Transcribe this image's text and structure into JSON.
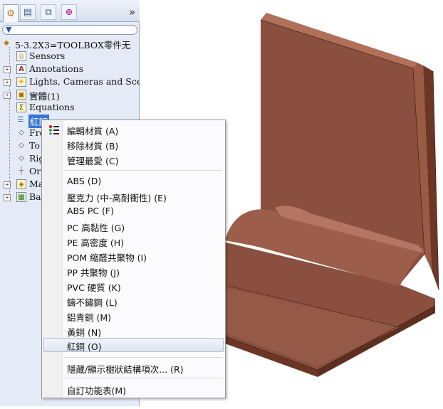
{
  "panel": {
    "tabs": [
      {
        "name": "feature-manager-tab-icon",
        "glyph": "⚙"
      },
      {
        "name": "property-manager-tab-icon",
        "glyph": "▤"
      },
      {
        "name": "configuration-manager-tab-icon",
        "glyph": "⧉"
      },
      {
        "name": "dimxpert-tab-icon",
        "glyph": "⊕"
      }
    ],
    "more_glyph": "»",
    "filter_glyph": "▼",
    "tree": {
      "root": "5-3.2X3=TOOLBOX零件无",
      "items": [
        {
          "label": "Sensors",
          "icon": "sensor-icon",
          "glyph": "◎",
          "expandable": false
        },
        {
          "label": "Annotations",
          "icon": "annotation-icon",
          "glyph": "A",
          "expandable": true
        },
        {
          "label": "Lights, Cameras and Scene",
          "icon": "lights-icon",
          "glyph": "☀",
          "expandable": true
        },
        {
          "label": "實體(1)",
          "icon": "solid-bodies-icon",
          "glyph": "▣",
          "expandable": true
        },
        {
          "label": "Equations",
          "icon": "equations-icon",
          "glyph": "Σ",
          "expandable": false
        },
        {
          "label": "紅銅",
          "icon": "material-icon",
          "glyph": "☰",
          "expandable": false
        },
        {
          "label": "Fro",
          "icon": "plane-icon",
          "glyph": "◇",
          "expandable": false
        },
        {
          "label": "To",
          "icon": "plane-icon",
          "glyph": "◇",
          "expandable": false
        },
        {
          "label": "Rig",
          "icon": "plane-icon",
          "glyph": "◇",
          "expandable": false
        },
        {
          "label": "Or",
          "icon": "origin-icon",
          "glyph": "┼",
          "expandable": false
        },
        {
          "label": "Ma",
          "icon": "macro-feature-icon",
          "glyph": "◈",
          "expandable": true
        },
        {
          "label": "Ba",
          "icon": "base-flange-icon",
          "glyph": "▦",
          "expandable": true
        }
      ]
    }
  },
  "context_menu": {
    "top_items": [
      {
        "label": "編輯材質 (A)"
      },
      {
        "label": "移除材質 (B)"
      },
      {
        "label": "管理最愛 (C)"
      }
    ],
    "materials": [
      {
        "label": "ABS (D)"
      },
      {
        "label": "壓克力 (中-高耐衝性) (E)"
      },
      {
        "label": "ABS PC (F)"
      },
      {
        "label": "PC 高黏性 (G)"
      },
      {
        "label": "PE 高密度 (H)"
      },
      {
        "label": "POM 縮醛共聚物 (I)"
      },
      {
        "label": "PP 共聚物 (J)"
      },
      {
        "label": "PVC 硬質 (K)"
      },
      {
        "label": "鑄不鏽鋼 (L)"
      },
      {
        "label": "鋁青銅 (M)"
      },
      {
        "label": "黃銅 (N)"
      },
      {
        "label": "紅銅 (O)"
      }
    ],
    "highlighted": "紅銅 (O)",
    "bottom_items": [
      {
        "label": "隱藏/顯示樹狀結構項次... (R)"
      },
      {
        "label": "自訂功能表(M)"
      }
    ]
  },
  "model": {
    "color_front": "#8a4f3e",
    "color_light": "#b0705a",
    "color_dark": "#6b3626"
  }
}
